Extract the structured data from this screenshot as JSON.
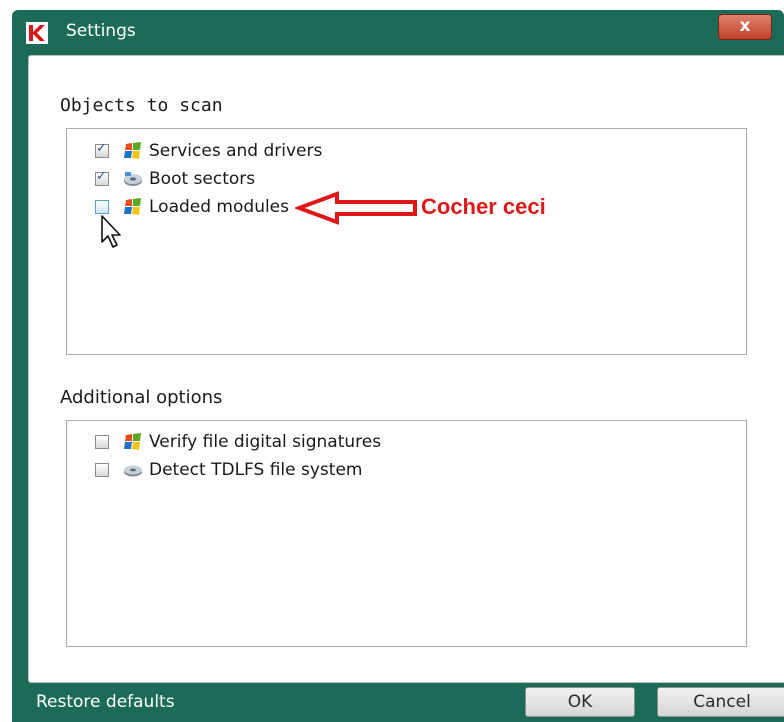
{
  "window": {
    "title": "Settings",
    "close_label": "x"
  },
  "objects_section": {
    "title": "Objects to scan",
    "items": [
      {
        "label": "Services and drivers",
        "checked": true,
        "icon": "windows-flag-icon"
      },
      {
        "label": "Boot sectors",
        "checked": true,
        "icon": "disk-icon"
      },
      {
        "label": "Loaded modules",
        "checked": false,
        "icon": "windows-flag-icon"
      }
    ]
  },
  "annotation": {
    "text": "Cocher ceci",
    "color": "#e01818"
  },
  "additional_section": {
    "title": "Additional options",
    "items": [
      {
        "label": "Verify file digital signatures",
        "checked": false,
        "icon": "windows-flag-icon"
      },
      {
        "label": "Detect TDLFS file system",
        "checked": false,
        "icon": "disk-icon"
      }
    ]
  },
  "footer": {
    "restore_label": "Restore defaults",
    "ok_label": "OK",
    "cancel_label": "Cancel"
  },
  "colors": {
    "frame": "#1c6b58",
    "close_button": "#c2412a",
    "accent": "#2f55a6"
  }
}
